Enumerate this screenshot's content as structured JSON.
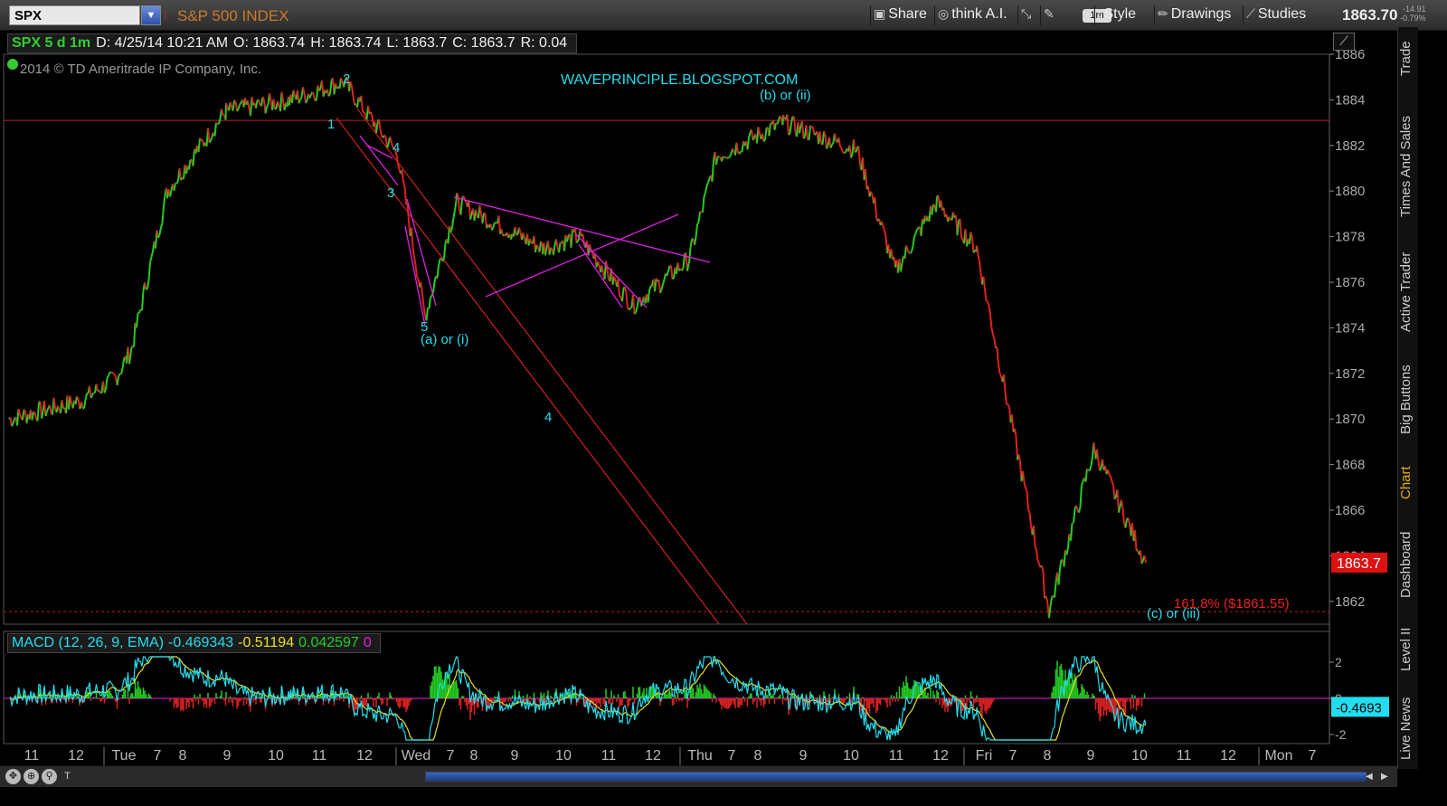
{
  "toolbar": {
    "symbol": "SPX",
    "symbol_dropdown": "▼",
    "index_name": "S&P 500 INDEX",
    "share": "Share",
    "think_ai": "think A.I.",
    "timeframe_badge": "1m",
    "style": "Style",
    "drawings": "Drawings",
    "studies": "Studies",
    "last_price": "1863.70",
    "net_change": "-14.91",
    "pct_change": "-0.79%"
  },
  "info_bar": {
    "symbol_period": "SPX 5 d 1m",
    "date": "D: 4/25/14 10:21 AM",
    "open": "O: 1863.74",
    "high": "H: 1863.74",
    "low": "L: 1863.7",
    "close": "C: 1863.7",
    "range": "R: 0.04"
  },
  "copyright": "2014 © TD Ameritrade IP Company, Inc.",
  "macd_bar": {
    "label": "MACD (12, 26, 9, EMA)",
    "value": "-0.469343",
    "avg": "-0.51194",
    "diff": "0.042597",
    "zero": "0"
  },
  "side_tabs": [
    "Trade",
    "Times And Sales",
    "Active Trader",
    "Big Buttons",
    "Chart",
    "Dashboard",
    "Level II",
    "Live News"
  ],
  "side_tab_active": "Chart",
  "chart_data": [
    {
      "type": "line",
      "title": "",
      "subtitle": "WAVEPRINCIPLE.BLOGSPOT.COM",
      "ylim": [
        1861,
        1886
      ],
      "yticks": [
        1862,
        1864,
        1866,
        1868,
        1870,
        1872,
        1874,
        1876,
        1878,
        1880,
        1882,
        1884,
        1886
      ],
      "xticks": [
        "11",
        "12",
        "Tue",
        "7",
        "8",
        "9",
        "10",
        "11",
        "12",
        "Wed",
        "7",
        "8",
        "9",
        "10",
        "11",
        "12",
        "Thu",
        "7",
        "8",
        "9",
        "10",
        "11",
        "12",
        "Fri",
        "7",
        "8",
        "9",
        "10",
        "11",
        "12",
        "Mon",
        "7"
      ],
      "x": [
        "Mon 11:00",
        "Mon 12:00",
        "Tue 07:00",
        "Tue 08:00",
        "Tue 09:00",
        "Tue 10:00",
        "Tue 11:00",
        "Tue 12:00",
        "Wed 07:00",
        "Wed 08:00",
        "Wed 09:00",
        "Wed 10:00",
        "Wed 11:00",
        "Wed 12:00",
        "Thu 07:00",
        "Thu 08:00",
        "Thu 09:00",
        "Thu 10:00",
        "Thu 11:00",
        "Thu 12:00",
        "Fri 07:00",
        "Fri 08:00",
        "Fri 09:00",
        "Fri 10:00"
      ],
      "series": [
        {
          "values": [
            1870,
            1870.8,
            1871.8,
            1873,
            1880,
            1883.5,
            1884,
            1884.8,
            1881.6,
            1874.5,
            1879.5,
            1877.5,
            1878,
            1875,
            1877,
            1881.5,
            1883,
            1881.8,
            1876.5,
            1879.5,
            1877.5,
            1861.6,
            1868.7,
            1863.7
          ]
        }
      ],
      "last_price_label": "1863.7",
      "horizontal_lines": [
        {
          "value": 1883.1,
          "color": "#c02020"
        },
        {
          "value": 1861.55,
          "color": "#c02020",
          "label": "161.8%  ($1861.55)"
        }
      ],
      "annotations": [
        "1",
        "2",
        "3",
        "4",
        "5",
        "(a) or (i)",
        "4",
        "(b) or (ii)",
        "(c) or (iii)"
      ],
      "colors": {
        "up": "#22cc22",
        "down": "#dd2222",
        "wave_labels": "#22ddee",
        "trendlines": "#e020e0",
        "channel": "#c02020",
        "last_price_box": "#dd1111"
      }
    },
    {
      "type": "line",
      "title": "MACD (12, 26, 9, EMA)",
      "ylim": [
        -2.5,
        2.5
      ],
      "yticks": [
        -2,
        0,
        2
      ],
      "last_value_label": "-0.4693",
      "series": [
        {
          "name": "MACD",
          "color": "#22ddee"
        },
        {
          "name": "Avg",
          "color": "#e8e020"
        },
        {
          "name": "Diff",
          "color": "#22cc22"
        }
      ]
    }
  ]
}
